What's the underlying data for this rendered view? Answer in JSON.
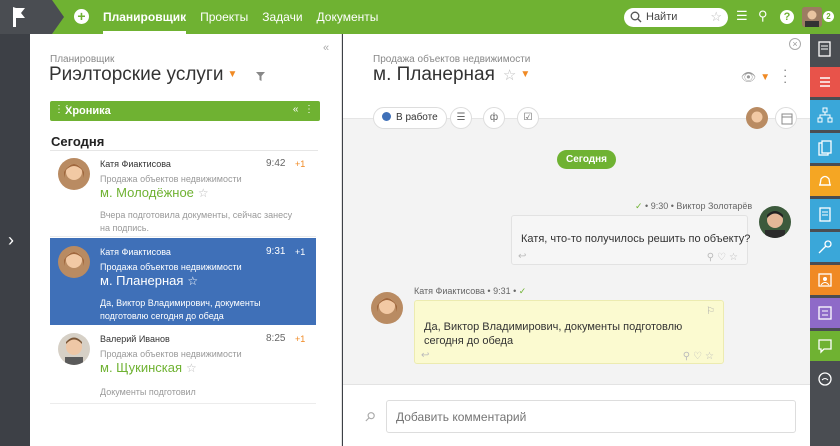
{
  "topbar": {
    "nav": [
      {
        "label": "Планировщик",
        "active": true
      },
      {
        "label": "Проекты",
        "active": false
      },
      {
        "label": "Задачи",
        "active": false
      },
      {
        "label": "Документы",
        "active": false
      }
    ],
    "search_placeholder": "Найти",
    "notifications_count": "2",
    "accent_color": "#6fb232"
  },
  "left": {
    "breadcrumb": "Планировщик",
    "title": "Риэлторские услуги",
    "chronicle_label": "Хроника",
    "today_heading": "Сегодня",
    "items": [
      {
        "author": "Катя Фиактисова",
        "time": "9:42",
        "plus": "+1",
        "subject": "Продажа объектов недвижимости",
        "object": "м. Молодёжное",
        "text": "Вчера подготовила документы, сейчас занесу на подпись.",
        "selected": false
      },
      {
        "author": "Катя Фиактисова",
        "time": "9:31",
        "plus": "+1",
        "subject": "Продажа объектов недвижимости",
        "object": "м. Планерная",
        "text": "Да, Виктор Владимирович, документы подготовлю сегодня до обеда",
        "selected": true
      },
      {
        "author": "Валерий Иванов",
        "time": "8:25",
        "plus": "+1",
        "subject": "Продажа объектов недвижимости",
        "object": "м. Щукинская",
        "text": "Документы подготовил",
        "selected": false
      }
    ]
  },
  "main": {
    "breadcrumb": "Продажа объектов недвижимости",
    "title": "м. Планерная",
    "status_label": "В работе",
    "today_label": "Сегодня",
    "msg_right": {
      "time": "9:30",
      "author": "Виктор Золотарёв",
      "text": "Катя, что-то получилось решить по объекту?"
    },
    "msg_left": {
      "author": "Катя Фиактисова",
      "time": "9:31",
      "text": "Да, Виктор Владимирович, документы подготовлю сегодня до обеда"
    },
    "comment_placeholder": "Добавить комментарий"
  },
  "right_rail": {
    "icons": [
      {
        "name": "edit-note-icon",
        "color": "#4a4d52"
      },
      {
        "name": "list-icon",
        "color": "#e8534a"
      },
      {
        "name": "structure-icon",
        "color": "#3aa7d9"
      },
      {
        "name": "documents-icon",
        "color": "#3aa7d9"
      },
      {
        "name": "bell-icon",
        "color": "#f5a623"
      },
      {
        "name": "clipboard-icon",
        "color": "#3aa7d9"
      },
      {
        "name": "key-icon",
        "color": "#3aa7d9"
      },
      {
        "name": "contact-card-icon",
        "color": "#f08a24"
      },
      {
        "name": "catalog-icon",
        "color": "#8e6ac8"
      },
      {
        "name": "chat-icon",
        "color": "#6fb232"
      },
      {
        "name": "clock-icon",
        "color": "#4a4d52"
      }
    ]
  }
}
